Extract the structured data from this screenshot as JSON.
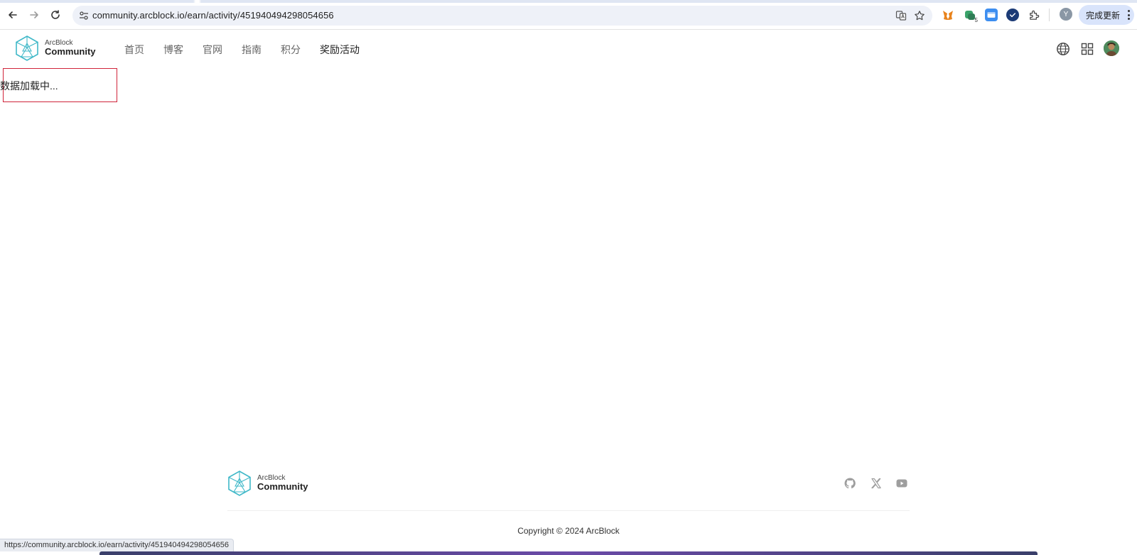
{
  "browser": {
    "url": "community.arcblock.io/earn/activity/451940494298054656",
    "update_label": "完成更新",
    "profile_initial": "Y",
    "extension_badge": "5",
    "status_url": "https://community.arcblock.io/earn/activity/451940494298054656"
  },
  "header": {
    "logo_small": "ArcBlock",
    "logo_big": "Community",
    "nav": [
      {
        "label": "首页"
      },
      {
        "label": "博客"
      },
      {
        "label": "官网"
      },
      {
        "label": "指南"
      },
      {
        "label": "积分"
      },
      {
        "label": "奖励活动"
      }
    ]
  },
  "main": {
    "loading_text": "数据加载中..."
  },
  "footer": {
    "logo_small": "ArcBlock",
    "logo_big": "Community",
    "copyright": "Copyright © 2024 ArcBlock"
  },
  "colors": {
    "accent_teal": "#3fb8c8",
    "highlight_red": "#d0243a"
  }
}
